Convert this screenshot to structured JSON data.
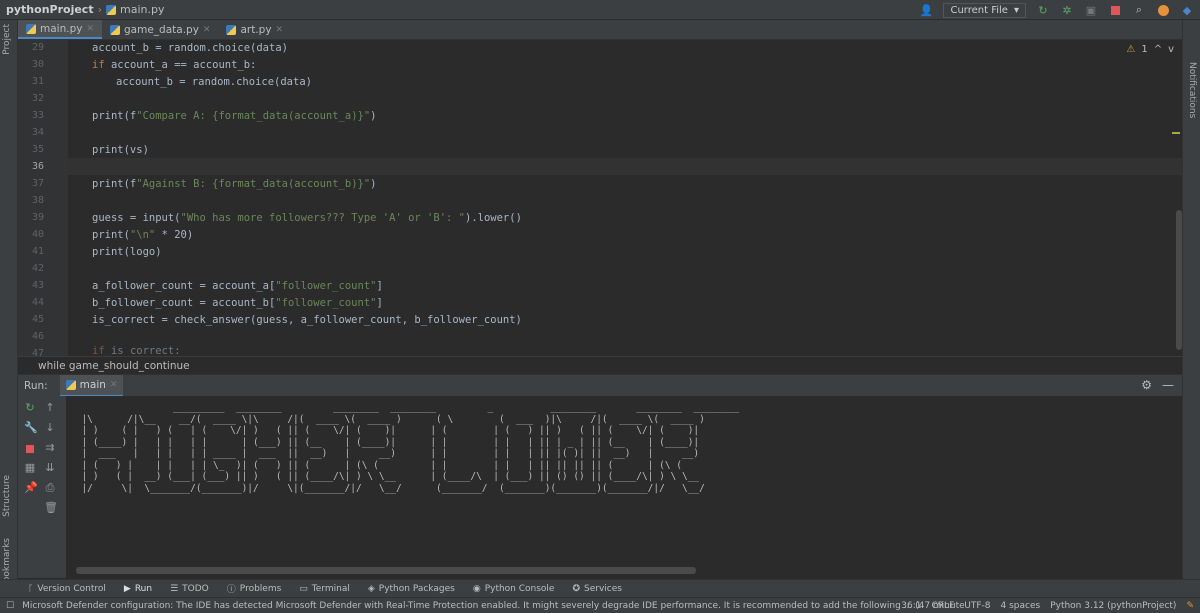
{
  "nav": {
    "project": "pythonProject",
    "file": "main.py",
    "run_config": "Current File"
  },
  "left_strip": {
    "project": "Project",
    "structure": "Structure",
    "bookmarks": "Bookmarks"
  },
  "right_strip": {
    "notifications": "Notifications"
  },
  "tabs": [
    {
      "label": "main.py",
      "active": true
    },
    {
      "label": "game_data.py",
      "active": false
    },
    {
      "label": "art.py",
      "active": false
    }
  ],
  "inspection": {
    "warnings": "1"
  },
  "editor": {
    "lines": [
      {
        "n": "29",
        "code": "account_b = random.choice(data)"
      },
      {
        "n": "30",
        "code": "if account_a == account_b:"
      },
      {
        "n": "31",
        "code": "account_b = random.choice(data)"
      },
      {
        "n": "32",
        "code": ""
      },
      {
        "n": "33",
        "code": "print(f\"Compare A: {format_data(account_a)}\")"
      },
      {
        "n": "34",
        "code": ""
      },
      {
        "n": "35",
        "code": "print(vs)"
      },
      {
        "n": "36",
        "code": ""
      },
      {
        "n": "37",
        "code": "print(f\"Against B: {format_data(account_b)}\")"
      },
      {
        "n": "38",
        "code": ""
      },
      {
        "n": "39",
        "code": "guess = input(\"Who has more followers??? Type 'A' or 'B': \").lower()"
      },
      {
        "n": "40",
        "code": "print(\"\\n\" * 20)"
      },
      {
        "n": "41",
        "code": "print(logo)"
      },
      {
        "n": "42",
        "code": ""
      },
      {
        "n": "43",
        "code": "a_follower_count = account_a[\"follower_count\"]"
      },
      {
        "n": "44",
        "code": "b_follower_count = account_b[\"follower_count\"]"
      },
      {
        "n": "45",
        "code": "is_correct = check_answer(guess, a_follower_count, b_follower_count)"
      },
      {
        "n": "46",
        "code": ""
      },
      {
        "n": "47",
        "code": "if is_correct:"
      }
    ]
  },
  "breadcrumb": "while game_should_continue",
  "run": {
    "label": "Run:",
    "tab": "main"
  },
  "console_art": "                  _________  ________         ________  ________         _          ________       ________  ________\n  |\\      /|\\__    __/(  ____ \\|\\     /|(  ____ \\(  ____ )      ( \\        (  ___  )|\\     /|(  ____ \\(  ____ )\n  | )    ( |   ) (   | (    \\/| )   ( || (    \\/| (    )|      | (        | (   ) || )   ( || (    \\/| (    )|\n  | (____) |   | |   | |      | (___) || (__    | (____)|      | |        | |   | || | _ | || (__    | (____)|\n  |  ___   |   | |   | | ____ |  ___  ||  __)   |     __)      | |        | |   | || |( )| ||  __)   |     __)\n  | (   ) |    | |   | | \\_  )| (   ) || (      | (\\ (         | |        | |   | || || || || (      | (\\ (\n  | )   ( |  __) (___| (___) || )   ( || (____/\\| ) \\ \\__      | (____/\\  | (___) || () () || (____/\\| ) \\ \\__\n  |/     \\|  \\_______/(_______)|/     \\|(_______/|/   \\__/      (_______/  (_______)(_______)(_______/|/   \\__/",
  "bottom_tools": [
    {
      "label": "Version Control",
      "icon": "branch-icon"
    },
    {
      "label": "Run",
      "icon": "play-icon",
      "active": true
    },
    {
      "label": "TODO",
      "icon": "list-icon"
    },
    {
      "label": "Problems",
      "icon": "alert-icon"
    },
    {
      "label": "Terminal",
      "icon": "terminal-icon"
    },
    {
      "label": "Python Packages",
      "icon": "packages-icon"
    },
    {
      "label": "Python Console",
      "icon": "python-icon"
    },
    {
      "label": "Services",
      "icon": "services-icon"
    }
  ],
  "status": {
    "message": "Microsoft Defender configuration: The IDE has detected Microsoft Defender with Real-Time Protection enabled. It might severely degrade IDE performance. It is recommended to add the following ... (47 minute",
    "position": "36:1",
    "line_sep": "CRLF",
    "encoding": "UTF-8",
    "indent": "4 spaces",
    "interpreter": "Python 3.12 (pythonProject)"
  },
  "colors": {
    "keyword": "#cc7832",
    "string": "#6a8759",
    "accent": "#4a88c7",
    "run_green": "#59a869",
    "stop_red": "#e05555"
  }
}
